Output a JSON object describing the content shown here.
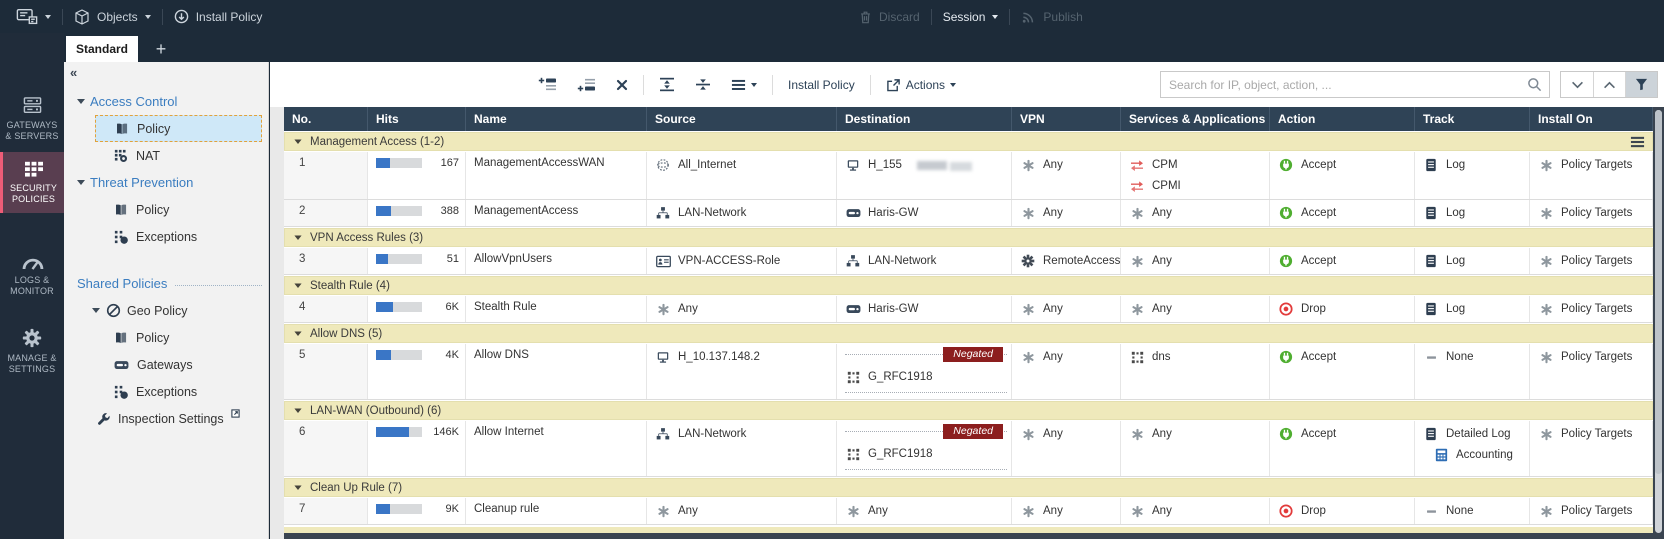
{
  "topbar": {
    "objects_label": "Objects",
    "install_policy_label": "Install Policy",
    "discard_label": "Discard",
    "session_label": "Session",
    "publish_label": "Publish"
  },
  "tabs": {
    "active_label": "Standard"
  },
  "sidebar": {
    "items": [
      {
        "id": "gateways-servers",
        "lines": [
          "GATEWAYS",
          "& SERVERS"
        ],
        "active": false
      },
      {
        "id": "security-policies",
        "lines": [
          "SECURITY",
          "POLICIES"
        ],
        "active": true
      },
      {
        "id": "logs-monitor",
        "lines": [
          "LOGS &",
          "MONITOR"
        ],
        "active": false
      },
      {
        "id": "manage-settings",
        "lines": [
          "MANAGE &",
          "SETTINGS"
        ],
        "active": false
      }
    ]
  },
  "nav": {
    "ac_label": "Access Control",
    "ac_policy": "Policy",
    "ac_nat": "NAT",
    "tp_label": "Threat Prevention",
    "tp_policy": "Policy",
    "tp_exceptions": "Exceptions",
    "shared_label": "Shared Policies",
    "geo_label": "Geo Policy",
    "geo_policy": "Policy",
    "geo_gateways": "Gateways",
    "geo_exceptions": "Exceptions",
    "inspection_label": "Inspection Settings"
  },
  "toolbar": {
    "install_policy_label": "Install Policy",
    "actions_label": "Actions",
    "search_placeholder": "Search for IP, object, action, ..."
  },
  "colors": {
    "header_bg": "#2f4356",
    "section_bg": "#efe9bb",
    "hits_bar_blue": "#3a76c6",
    "negated_bg": "#8c1e1e",
    "accept_green": "#4fae30",
    "drop_red": "#e23b3b",
    "active_sidebar_pink": "#ee5c77",
    "selected_tree_bg": "#cfe8f8"
  },
  "table": {
    "columns": [
      "No.",
      "Hits",
      "Name",
      "Source",
      "Destination",
      "VPN",
      "Services & Applications",
      "Action",
      "Track",
      "Install On"
    ],
    "negated_label": "Negated",
    "groups": [
      {
        "title": "Management Access (1-2)",
        "menu_icon": true,
        "rows": [
          {
            "no": "1",
            "hits": {
              "value": "167",
              "pct": 30
            },
            "name": "ManagementAccessWAN",
            "source": [
              {
                "icon": "internet",
                "label": "All_Internet"
              }
            ],
            "destination": {
              "negated": false,
              "items": [
                {
                  "icon": "host",
                  "label": "H_155",
                  "redacted": true
                }
              ]
            },
            "vpn": [
              {
                "icon": "any",
                "label": "Any"
              }
            ],
            "services": [
              {
                "icon": "tcp",
                "label": "CPM"
              },
              {
                "icon": "tcp",
                "label": "CPMI"
              }
            ],
            "action": {
              "icon": "accept",
              "label": "Accept"
            },
            "track": [
              {
                "icon": "log",
                "label": "Log"
              }
            ],
            "install_on": [
              {
                "icon": "any",
                "label": "Policy Targets"
              }
            ]
          },
          {
            "no": "2",
            "hits": {
              "value": "388",
              "pct": 33
            },
            "name": "ManagementAccess",
            "source": [
              {
                "icon": "network",
                "label": "LAN-Network"
              }
            ],
            "destination": {
              "negated": false,
              "items": [
                {
                  "icon": "gateway",
                  "label": "Haris-GW"
                }
              ]
            },
            "vpn": [
              {
                "icon": "any",
                "label": "Any"
              }
            ],
            "services": [
              {
                "icon": "any",
                "label": "Any"
              }
            ],
            "action": {
              "icon": "accept",
              "label": "Accept"
            },
            "track": [
              {
                "icon": "log",
                "label": "Log"
              }
            ],
            "install_on": [
              {
                "icon": "any",
                "label": "Policy Targets"
              }
            ]
          }
        ]
      },
      {
        "title": "VPN Access Rules (3)",
        "menu_icon": false,
        "rows": [
          {
            "no": "3",
            "hits": {
              "value": "51",
              "pct": 25
            },
            "name": "AllowVpnUsers",
            "source": [
              {
                "icon": "role",
                "label": "VPN-ACCESS-Role"
              }
            ],
            "destination": {
              "negated": false,
              "items": [
                {
                  "icon": "network",
                  "label": "LAN-Network"
                }
              ]
            },
            "vpn": [
              {
                "icon": "remote",
                "label": "RemoteAccess"
              }
            ],
            "services": [
              {
                "icon": "any",
                "label": "Any"
              }
            ],
            "action": {
              "icon": "accept",
              "label": "Accept"
            },
            "track": [
              {
                "icon": "log",
                "label": "Log"
              }
            ],
            "install_on": [
              {
                "icon": "any",
                "label": "Policy Targets"
              }
            ]
          }
        ]
      },
      {
        "title": "Stealth Rule (4)",
        "menu_icon": false,
        "rows": [
          {
            "no": "4",
            "hits": {
              "value": "6K",
              "pct": 38
            },
            "name": "Stealth Rule",
            "source": [
              {
                "icon": "any",
                "label": "Any"
              }
            ],
            "destination": {
              "negated": false,
              "items": [
                {
                  "icon": "gateway",
                  "label": "Haris-GW"
                }
              ]
            },
            "vpn": [
              {
                "icon": "any",
                "label": "Any"
              }
            ],
            "services": [
              {
                "icon": "any",
                "label": "Any"
              }
            ],
            "action": {
              "icon": "drop",
              "label": "Drop"
            },
            "track": [
              {
                "icon": "log",
                "label": "Log"
              }
            ],
            "install_on": [
              {
                "icon": "any",
                "label": "Policy Targets"
              }
            ]
          }
        ]
      },
      {
        "title": "Allow DNS (5)",
        "menu_icon": false,
        "rows": [
          {
            "no": "5",
            "hits": {
              "value": "4K",
              "pct": 33
            },
            "name": "Allow DNS",
            "source": [
              {
                "icon": "host",
                "label": "H_10.137.148.2"
              }
            ],
            "destination": {
              "negated": true,
              "items": [
                {
                  "icon": "group",
                  "label": "G_RFC1918"
                }
              ]
            },
            "vpn": [
              {
                "icon": "any",
                "label": "Any"
              }
            ],
            "services": [
              {
                "icon": "group",
                "label": "dns"
              }
            ],
            "action": {
              "icon": "accept",
              "label": "Accept"
            },
            "track": [
              {
                "icon": "none",
                "label": "None"
              }
            ],
            "install_on": [
              {
                "icon": "any",
                "label": "Policy Targets"
              }
            ]
          }
        ]
      },
      {
        "title": "LAN-WAN (Outbound) (6)",
        "menu_icon": false,
        "rows": [
          {
            "no": "6",
            "hits": {
              "value": "146K",
              "pct": 72
            },
            "name": "Allow Internet",
            "source": [
              {
                "icon": "network",
                "label": "LAN-Network"
              }
            ],
            "destination": {
              "negated": true,
              "items": [
                {
                  "icon": "group",
                  "label": "G_RFC1918"
                }
              ]
            },
            "vpn": [
              {
                "icon": "any",
                "label": "Any"
              }
            ],
            "services": [
              {
                "icon": "any",
                "label": "Any"
              }
            ],
            "action": {
              "icon": "accept",
              "label": "Accept"
            },
            "track": [
              {
                "icon": "log",
                "label": "Detailed Log"
              },
              {
                "icon": "accounting",
                "label": "Accounting",
                "indent": true
              }
            ],
            "install_on": [
              {
                "icon": "any",
                "label": "Policy Targets"
              }
            ]
          }
        ]
      },
      {
        "title": "Clean Up Rule (7)",
        "menu_icon": false,
        "rows": [
          {
            "no": "7",
            "hits": {
              "value": "9K",
              "pct": 30
            },
            "name": "Cleanup rule",
            "source": [
              {
                "icon": "any",
                "label": "Any"
              }
            ],
            "destination": {
              "negated": false,
              "items": [
                {
                  "icon": "any",
                  "label": "Any"
                }
              ]
            },
            "vpn": [
              {
                "icon": "any",
                "label": "Any"
              }
            ],
            "services": [
              {
                "icon": "any",
                "label": "Any"
              }
            ],
            "action": {
              "icon": "drop",
              "label": "Drop"
            },
            "track": [
              {
                "icon": "none",
                "label": "None"
              }
            ],
            "install_on": [
              {
                "icon": "any",
                "label": "Policy Targets"
              }
            ]
          }
        ]
      }
    ]
  }
}
